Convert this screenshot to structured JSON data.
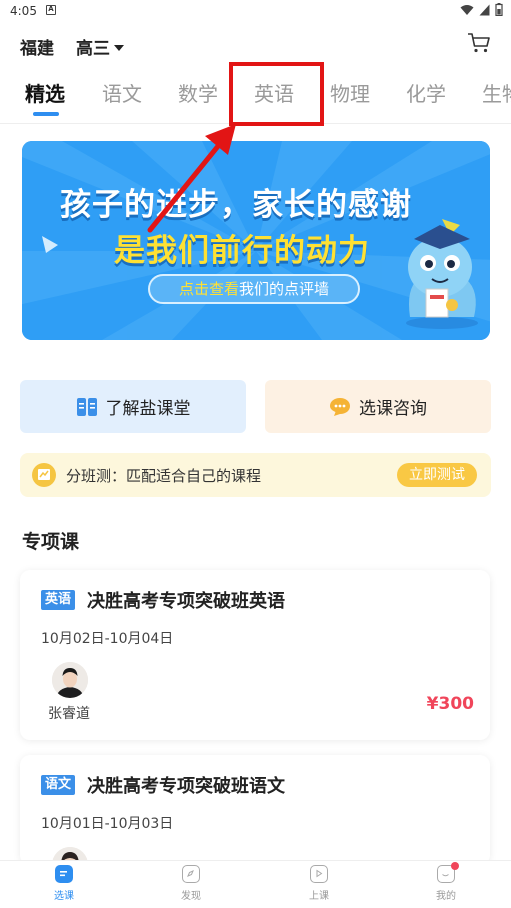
{
  "status_bar": {
    "time": "4:05",
    "notification_glyph": "A"
  },
  "header": {
    "region": "福建",
    "grade": "高三"
  },
  "tabs": [
    {
      "label": "精选",
      "active": true
    },
    {
      "label": "语文"
    },
    {
      "label": "数学"
    },
    {
      "label": "英语",
      "highlighted": true
    },
    {
      "label": "物理"
    },
    {
      "label": "化学"
    },
    {
      "label": "生物"
    }
  ],
  "banner": {
    "line1": "孩子的进步，家长的感谢",
    "line2": "是我们前行的动力",
    "cta_highlight": "点击查看",
    "cta_rest": "我们的点评墙"
  },
  "quick_actions": {
    "learn": "了解盐课堂",
    "consult": "选课咨询"
  },
  "placement_test": {
    "text": "分班测：匹配适合自己的课程",
    "button": "立即测试"
  },
  "section": {
    "title": "专项课"
  },
  "courses": [
    {
      "subject": "英语",
      "title": "决胜高考专项突破班英语",
      "dates": "10月02日-10月04日",
      "teacher": "张睿道",
      "price": "¥300"
    },
    {
      "subject": "语文",
      "title": "决胜高考专项突破班语文",
      "dates": "10月01日-10月03日"
    }
  ],
  "bottom_nav": [
    {
      "label": "选课",
      "active": true
    },
    {
      "label": "发现"
    },
    {
      "label": "上课"
    },
    {
      "label": "我的",
      "badge": true
    }
  ],
  "colors": {
    "accent": "#2e8ef0",
    "price": "#f0455a",
    "annotation": "#e21515",
    "banner": "#2f9ef5"
  }
}
